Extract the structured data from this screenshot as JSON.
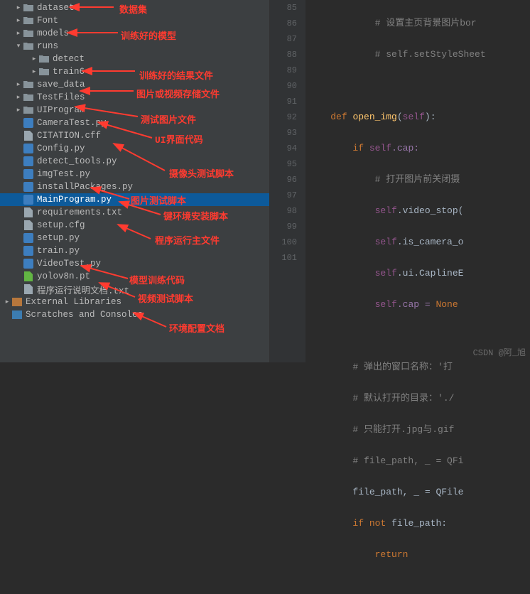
{
  "tree": {
    "datasets": "datasets",
    "font": "Font",
    "models": "models",
    "runs": "runs",
    "detect": "detect",
    "train6": "train6",
    "save_data": "save_data",
    "testfiles": "TestFiles",
    "uiprogram": "UIProgram",
    "cameratest": "CameraTest.py",
    "citation": "CITATION.cff",
    "config": "Config.py",
    "detect_tools": "detect_tools.py",
    "imgtest": "imgTest.py",
    "installpkg": "installPackages.py",
    "mainprogram": "MainProgram.py",
    "requirements": "requirements.txt",
    "setupcfg": "setup.cfg",
    "setuppy": "setup.py",
    "train": "train.py",
    "videotest": "VideoTest.py",
    "yolov8n": "yolov8n.pt",
    "readme": "程序运行说明文档.txt",
    "extlib": "External Libraries",
    "scratch": "Scratches and Consoles"
  },
  "annotations": {
    "datasets": "数据集",
    "models": "训练好的模型",
    "runs": "训练好的结果文件",
    "save_data": "图片或视频存储文件",
    "testfiles": "测试图片文件",
    "uiprogram": "UI界面代码",
    "cameratest": "摄像头测试脚本",
    "imgtest": "图片测试脚本",
    "installpkg": "键环境安装脚本",
    "mainprogram": "程序运行主文件",
    "train": "模型训练代码",
    "videotest": "视频测试脚本",
    "readme": "环境配置文档"
  },
  "gutter": [
    "85",
    "86",
    "87",
    "88",
    "89",
    "90",
    "91",
    "92",
    "93",
    "94",
    "95",
    "96",
    "97",
    "98",
    "99",
    "100",
    "101"
  ],
  "code": {
    "l85": "# 设置主页背景图片bor",
    "l86": "# self.setStyleSheet",
    "l88_def": "def",
    "l88_fn": "open_img",
    "l88_self": "self",
    "l89_if": "if",
    "l89_self": "self",
    "l89_cap": ".cap:",
    "l90": "# 打开图片前关闭摄",
    "l91_self": "self",
    "l91_rest": ".video_stop(",
    "l92_self": "self",
    "l92_rest": ".is_camera_o",
    "l93_self": "self",
    "l93_rest": ".ui.CaplineE",
    "l94_self": "self",
    "l94_cap": ".cap = ",
    "l94_none": "None",
    "l96": "# 弹出的窗口名称：'打",
    "l97": "# 默认打开的目录：'./",
    "l98": "# 只能打开.jpg与.gif",
    "l99": "# file_path, _ = QFi",
    "l100": "file_path, _ = QFile",
    "l101_if": "if",
    "l101_not": "not",
    "l101_rest": " file_path:",
    "l102_ret": "return"
  },
  "watermark": "CSDN @阿_旭",
  "chart_data": null
}
